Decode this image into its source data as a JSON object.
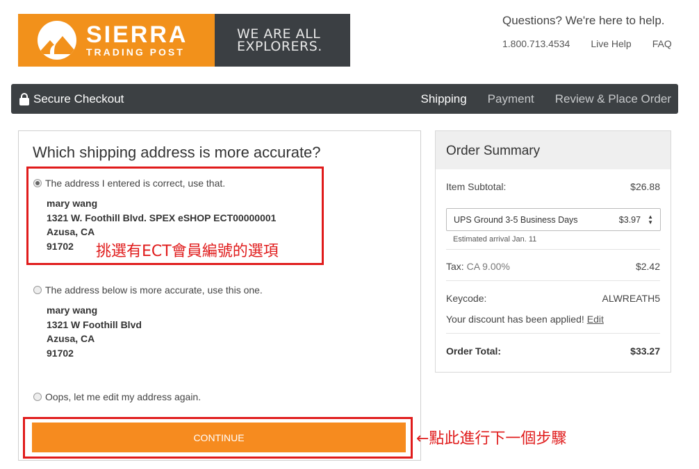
{
  "logo": {
    "brand_name": "SIERRA",
    "brand_sub": "TRADING POST",
    "tagline_line1": "WE ARE ALL",
    "tagline_line2": "EXPLORERS."
  },
  "help": {
    "title": "Questions? We're here to help.",
    "phone": "1.800.713.4534",
    "live_help": "Live Help",
    "faq": "FAQ"
  },
  "nav": {
    "secure_label": "Secure Checkout",
    "steps": [
      "Shipping",
      "Payment",
      "Review & Place Order"
    ],
    "active_step": "Shipping"
  },
  "main": {
    "title": "Which shipping address is more accurate?",
    "option1": {
      "label": "The address I entered is correct, use that.",
      "name": "mary wang",
      "street": "1321 W. Foothill Blvd. SPEX eSHOP ECT00000001",
      "city": "Azusa, CA",
      "zip": "91702"
    },
    "option2": {
      "label": "The address below is more accurate, use this one.",
      "name": "mary wang",
      "street": "1321 W Foothill Blvd",
      "city": "Azusa, CA",
      "zip": "91702"
    },
    "option3": {
      "label": "Oops, let me edit my address again."
    },
    "continue_label": "CONTINUE"
  },
  "annotations": {
    "choose_ect": "挑選有ECT會員編號的選項",
    "next_step": "←點此進行下一個步驟"
  },
  "summary": {
    "title": "Order Summary",
    "subtotal_label": "Item Subtotal:",
    "subtotal_value": "$26.88",
    "shipping_method": "UPS Ground 3-5 Business Days",
    "shipping_price": "$3.97",
    "estimated_arrival": "Estimated arrival Jan. 11",
    "tax_label": "Tax:",
    "tax_detail": "CA 9.00%",
    "tax_value": "$2.42",
    "keycode_label": "Keycode:",
    "keycode_value": "ALWREATH5",
    "discount_text": "Your discount has been applied!",
    "edit_label": "Edit",
    "total_label": "Order Total:",
    "total_value": "$33.27"
  },
  "colors": {
    "brand_orange": "#f2911b",
    "button_orange": "#f68b1f",
    "nav_dark": "#3c4043",
    "annotation_red": "#e01b1b"
  }
}
